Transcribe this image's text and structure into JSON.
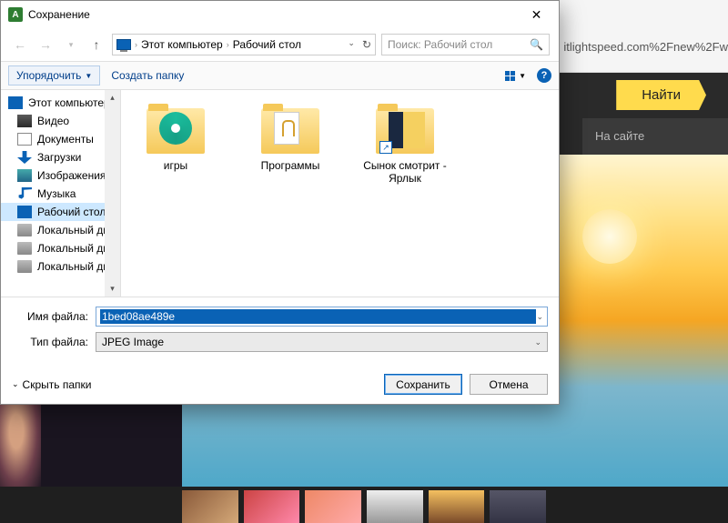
{
  "browser": {
    "url_fragment": "itlightspeed.com%2Fnew%2Fw",
    "find_label": "Найти",
    "tab_label": "На сайте"
  },
  "dialog": {
    "title": "Сохранение",
    "app_letter": "A",
    "breadcrumb": {
      "root": "Этот компьютер",
      "segment": "Рабочий стол"
    },
    "search_placeholder": "Поиск: Рабочий стол",
    "toolbar": {
      "organize": "Упорядочить",
      "new_folder": "Создать папку"
    },
    "sidebar": {
      "items": [
        {
          "label": "Этот компьютер",
          "icon": "i-pc",
          "top": true
        },
        {
          "label": "Видео",
          "icon": "i-video"
        },
        {
          "label": "Документы",
          "icon": "i-doc"
        },
        {
          "label": "Загрузки",
          "icon": "i-dl"
        },
        {
          "label": "Изображения",
          "icon": "i-img"
        },
        {
          "label": "Музыка",
          "icon": "i-music"
        },
        {
          "label": "Рабочий стол",
          "icon": "i-desktop",
          "selected": true
        },
        {
          "label": "Локальный дис",
          "icon": "i-disk"
        },
        {
          "label": "Локальный дис",
          "icon": "i-disk"
        },
        {
          "label": "Локальный дис",
          "icon": "i-disk"
        }
      ]
    },
    "content": {
      "items": [
        {
          "label": "игры",
          "kind": "disc"
        },
        {
          "label": "Программы",
          "kind": "page"
        },
        {
          "label": "Сынок смотрит - Ярлык",
          "kind": "photo",
          "shortcut": true
        }
      ]
    },
    "filename_label": "Имя файла:",
    "filename_value": "1bed08ae489e",
    "filetype_label": "Тип файла:",
    "filetype_value": "JPEG Image",
    "hide_folders": "Скрыть папки",
    "save_btn": "Сохранить",
    "cancel_btn": "Отмена"
  }
}
